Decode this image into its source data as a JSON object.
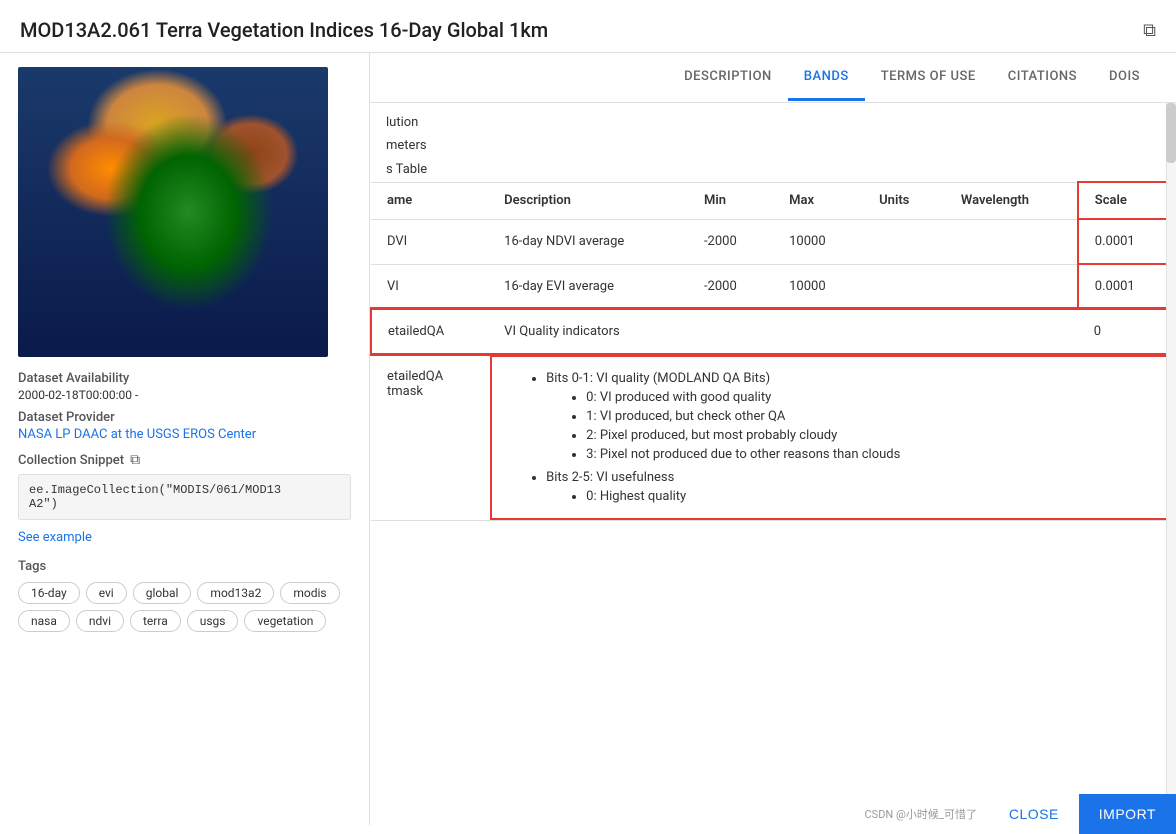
{
  "title": "MOD13A2.061 Terra Vegetation Indices 16-Day Global 1km",
  "externalIcon": "⧉",
  "tabs": [
    {
      "id": "description",
      "label": "DESCRIPTION",
      "active": false
    },
    {
      "id": "bands",
      "label": "BANDS",
      "active": true
    },
    {
      "id": "terms",
      "label": "TERMS OF USE",
      "active": false
    },
    {
      "id": "citations",
      "label": "CITATIONS",
      "active": false
    },
    {
      "id": "dois",
      "label": "DOIS",
      "active": false
    }
  ],
  "datasetInfo": {
    "availabilityLabel": "Dataset Availability",
    "availabilityValue": "2000-02-18T00:00:00 -",
    "providerLabel": "Dataset Provider",
    "providerLink": "NASA LP DAAC at the USGS EROS Center",
    "snippetLabel": "Collection Snippet",
    "snippetCode": "ee.ImageCollection(\"MODIS/061/MOD13\nA2\")",
    "seeExample": "See example",
    "tagsLabel": "Tags",
    "tags": [
      "16-day",
      "evi",
      "global",
      "mod13a2",
      "modis",
      "nasa",
      "ndvi",
      "terra",
      "usgs",
      "vegetation"
    ]
  },
  "bandsTable": {
    "partialTexts": [
      "lution",
      "meters",
      "s Table"
    ],
    "columns": [
      "ame",
      "Description",
      "Min",
      "Max",
      "Units",
      "Wavelength",
      "Scale"
    ],
    "rows": [
      {
        "name": "DVI",
        "description": "16-day NDVI average",
        "min": "-2000",
        "max": "10000",
        "units": "",
        "wavelength": "",
        "scale": "0.0001"
      },
      {
        "name": "VI",
        "description": "16-day EVI average",
        "min": "-2000",
        "max": "10000",
        "units": "",
        "wavelength": "",
        "scale": "0.0001"
      }
    ],
    "qaRow": {
      "name": "etailedQA",
      "description": "VI Quality indicators",
      "min": "",
      "max": "",
      "units": "",
      "wavelength": "",
      "scale": "0"
    },
    "qaDetailRow": {
      "name": "etailedQA\ntmask",
      "bullets": [
        {
          "text": "Bits 0-1: VI quality (MODLAND QA Bits)",
          "subItems": [
            "0: VI produced with good quality",
            "1: VI produced, but check other QA",
            "2: Pixel produced, but most probably cloudy",
            "3: Pixel not produced due to other reasons than clouds"
          ]
        },
        {
          "text": "Bits 2-5: VI usefulness",
          "subItems": [
            "0: Highest quality"
          ]
        }
      ]
    }
  },
  "bottomBar": {
    "watermark": "CSDN @小时候_可惜了",
    "closeLabel": "CLOSE",
    "importLabel": "IMPORT"
  }
}
